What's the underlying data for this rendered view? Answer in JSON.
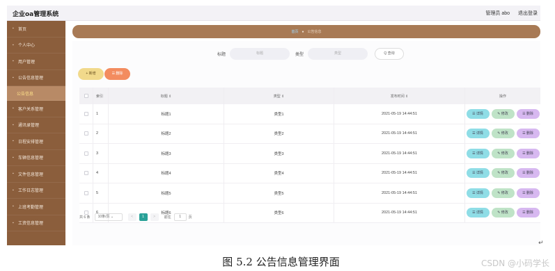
{
  "app": {
    "title": "企业oa管理系统"
  },
  "topbar": {
    "user_role": "管理员 abo",
    "logout": "退出登录"
  },
  "sidebar": {
    "items": [
      {
        "label": "首页",
        "icon": "home-icon"
      },
      {
        "label": "个人中心",
        "icon": "user-icon"
      },
      {
        "label": "用户管理",
        "icon": "users-icon"
      },
      {
        "label": "公告信息管理",
        "icon": "notice-icon"
      },
      {
        "label": "公告信息",
        "icon": "list-icon",
        "active": true
      },
      {
        "label": "客户关系管理",
        "icon": "client-icon"
      },
      {
        "label": "通讯录管理",
        "icon": "contacts-icon"
      },
      {
        "label": "日程安排管理",
        "icon": "calendar-icon"
      },
      {
        "label": "车辆信息管理",
        "icon": "car-icon"
      },
      {
        "label": "文件信息管理",
        "icon": "file-icon"
      },
      {
        "label": "工作日志管理",
        "icon": "log-icon"
      },
      {
        "label": "上班考勤管理",
        "icon": "clock-icon"
      },
      {
        "label": "工资信息管理",
        "icon": "salary-icon"
      }
    ]
  },
  "breadcrumb": {
    "home": "首页",
    "separator": "●",
    "current": "公告信息"
  },
  "search": {
    "title_label": "标题",
    "title_placeholder": "标题",
    "type_label": "类型",
    "type_placeholder": "类型",
    "button": "Q 查询"
  },
  "actions": {
    "add": "+ 新增",
    "delete": "☰ 删除"
  },
  "table": {
    "headers": {
      "index": "索引",
      "title": "标题 ⇕",
      "type": "类型 ⇕",
      "time": "发布时间 ⇕",
      "ops": "操作"
    },
    "rows": [
      {
        "index": "1",
        "title": "标题1",
        "type": "类型1",
        "time": "2021-05-19 14:44:51"
      },
      {
        "index": "2",
        "title": "标题2",
        "type": "类型2",
        "time": "2021-05-19 14:44:51"
      },
      {
        "index": "3",
        "title": "标题3",
        "type": "类型3",
        "time": "2021-05-19 14:44:51"
      },
      {
        "index": "4",
        "title": "标题4",
        "type": "类型4",
        "time": "2021-05-19 14:44:51"
      },
      {
        "index": "5",
        "title": "标题5",
        "type": "类型5",
        "time": "2021-05-19 14:44:51"
      },
      {
        "index": "6",
        "title": "标题6",
        "type": "类型6",
        "time": "2021-05-19 14:44:51"
      }
    ],
    "ops": {
      "detail": "☰ 详情",
      "edit": "✎ 修改",
      "delete": "☰ 删除"
    }
  },
  "pager": {
    "total": "共 6 条",
    "size": "10条/页 ⌄",
    "prev": "<",
    "page": "1",
    "next": ">",
    "goto": "前往",
    "goto_value": "1",
    "unit": "页"
  },
  "caption": "图 5.2 公告信息管理界面",
  "paragraph_mark": "↵",
  "watermark": "CSDN @小码学长",
  "colors": {
    "sidebar": "#8b5e3c",
    "breadcrumb": "#a87a55",
    "add": "#f1d98b",
    "delete": "#f38c5f",
    "detail": "#8fdde6",
    "edit": "#bfe3c7",
    "remove": "#d7b8f0",
    "page_active": "#2aa198"
  }
}
